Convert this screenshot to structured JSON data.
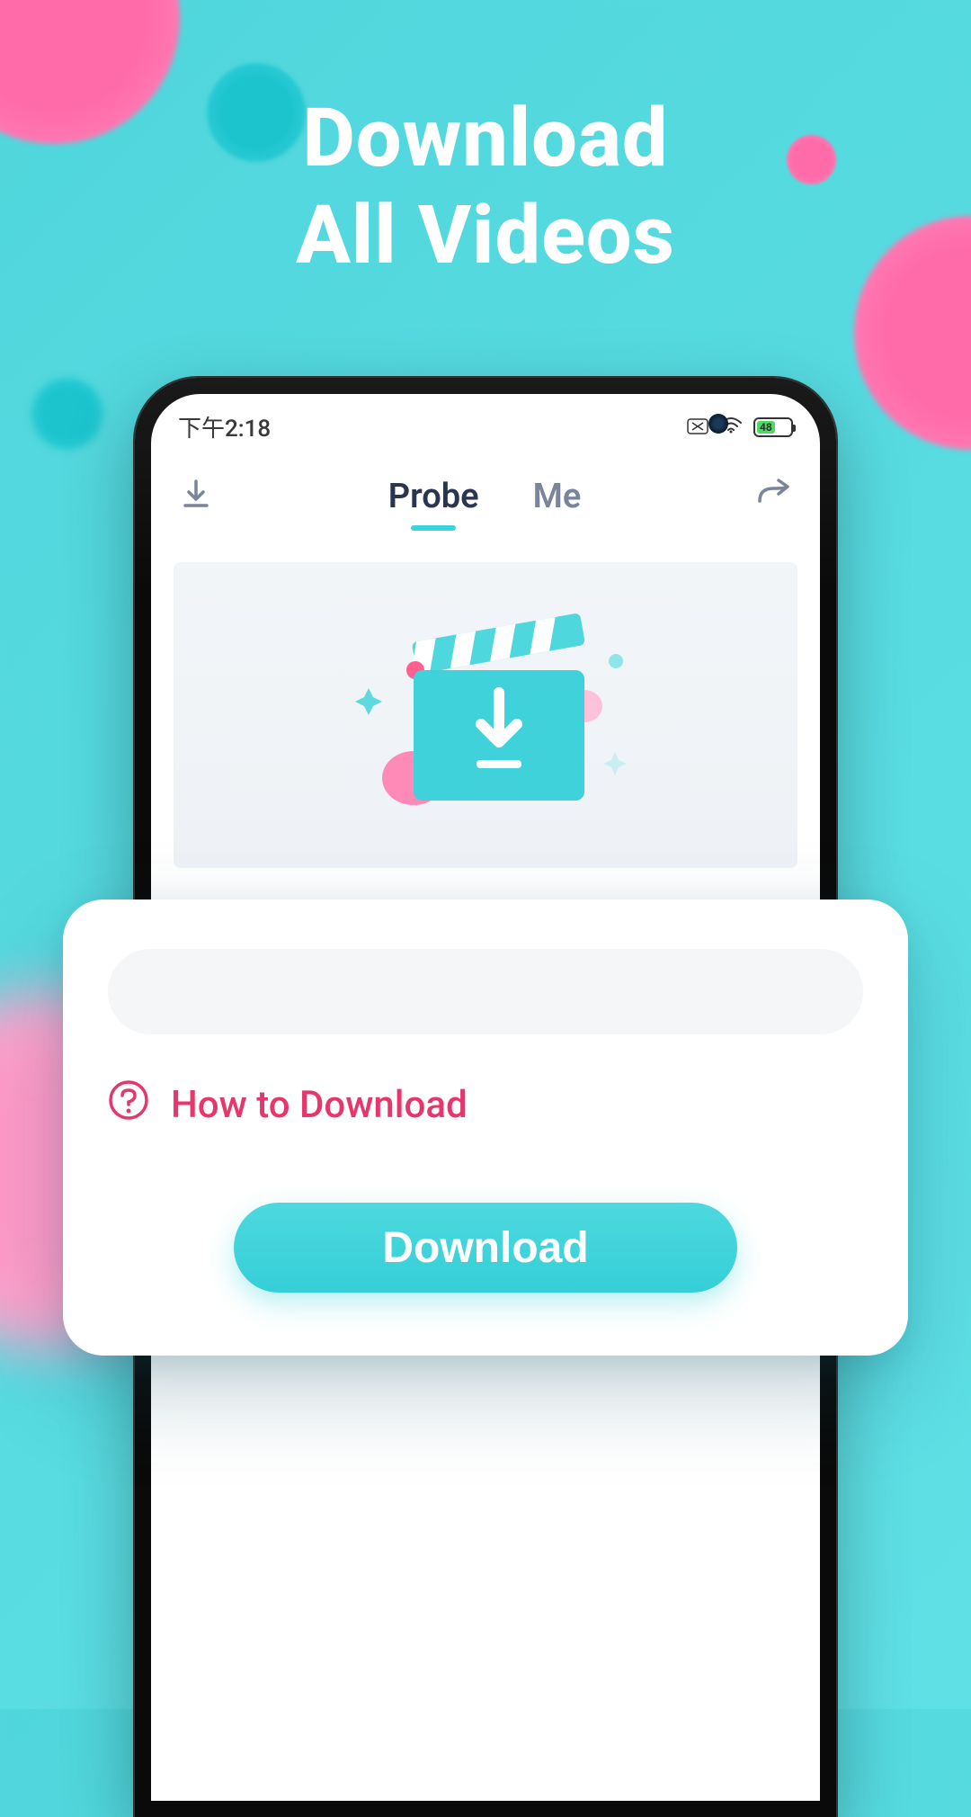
{
  "hero": {
    "line1": "Download",
    "line2": "All Videos"
  },
  "status": {
    "time": "下午2:18",
    "battery": "48"
  },
  "nav": {
    "tabs": [
      "Probe",
      "Me"
    ],
    "active": 0
  },
  "card": {
    "input_placeholder": "",
    "how_to_label": "How to Download",
    "download_label": "Download"
  },
  "colors": {
    "accent": "#3dd3dc",
    "pink": "#e5376b",
    "bg": "#5fe0e5"
  }
}
